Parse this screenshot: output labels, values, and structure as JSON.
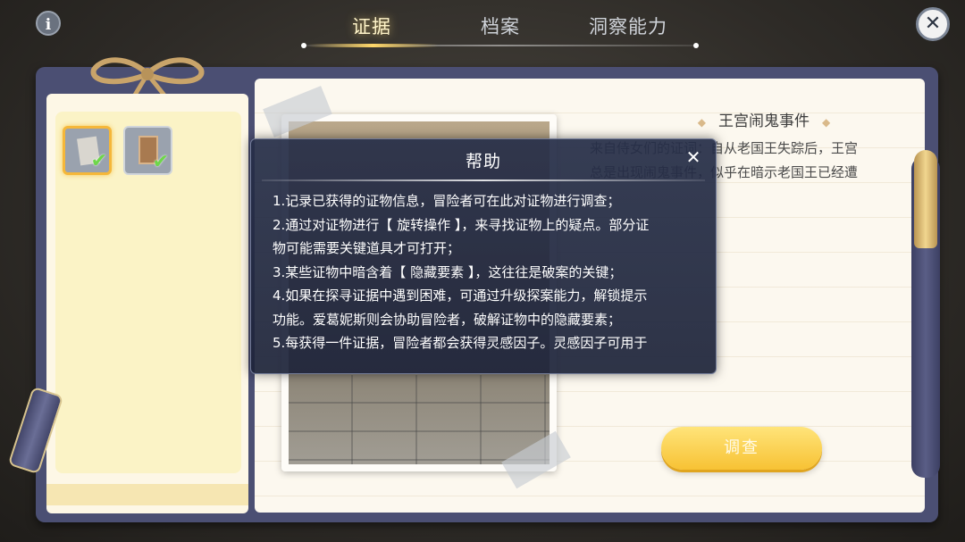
{
  "tabs": [
    {
      "label": "证据",
      "active": true
    },
    {
      "label": "档案",
      "active": false
    },
    {
      "label": "洞察能力",
      "active": false
    }
  ],
  "info_icon": "i",
  "close_icon": "✕",
  "evidence_slots": [
    {
      "item": "paper-note-icon",
      "collected": true,
      "selected": true
    },
    {
      "item": "portrait-card-icon",
      "collected": true,
      "selected": false
    }
  ],
  "case": {
    "title": "王宫闹鬼事件",
    "description_lines": [
      "来自侍女们的证词：自从老国王失踪后，王宫",
      "总是出现闹鬼事件，似乎在暗示老国王已经遭"
    ]
  },
  "investigate_button": "调查",
  "help": {
    "title": "帮助",
    "close": "✕",
    "lines": [
      "1.记录已获得的证物信息，冒险者可在此对证物进行调查；",
      "2.通过对证物进行【 旋转操作 】，来寻找证物上的疑点。部分证",
      "物可能需要关键道具才可打开；",
      "3.某些证物中暗含着【 隐藏要素 】，这往往是破案的关键；",
      "4.如果在探寻证据中遇到困难，可通过升级探案能力，解锁提示",
      "功能。爱葛妮斯则会协助冒险者，破解证物中的隐藏要素；",
      "5.每获得一件证据，冒险者都会获得灵感因子。灵感因子可用于"
    ]
  },
  "colors": {
    "frame": "#4b4f73",
    "accent_gold": "#f7c234",
    "active_tab": "#fff4c9",
    "check_green": "#6ed64a"
  }
}
